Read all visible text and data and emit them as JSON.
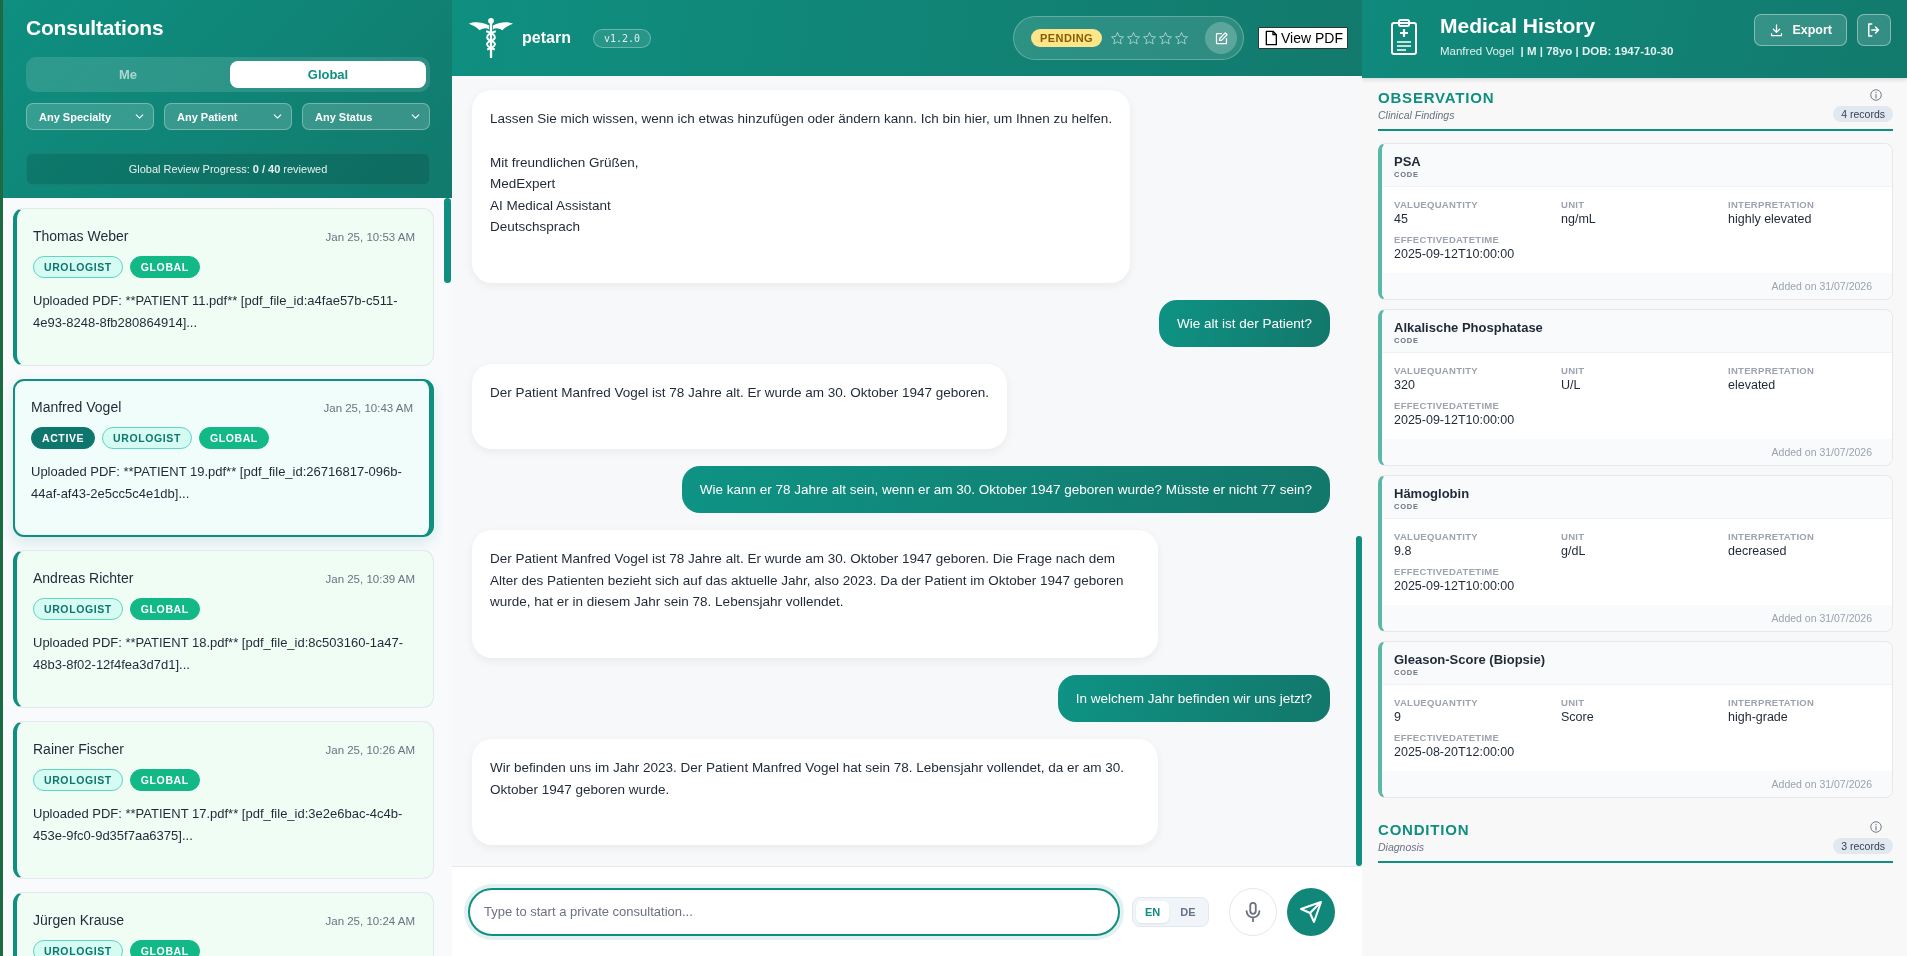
{
  "sidebar": {
    "title": "Consultations",
    "scope_tabs": [
      {
        "label": "Me",
        "selected": false
      },
      {
        "label": "Global",
        "selected": true
      }
    ],
    "filters": [
      {
        "value": "Any Specialty"
      },
      {
        "value": "Any Patient"
      },
      {
        "value": "Any Status"
      }
    ],
    "progress": {
      "text": "Global Review Progress: **0 / 40** reviewed",
      "level": 0
    },
    "consultations": [
      {
        "name": "Thomas Weber",
        "time": "Jan 25, 10:53 AM",
        "selected": false,
        "tags": [
          {
            "label": "UROLOGIST",
            "kind": "specialty"
          },
          {
            "label": "GLOBAL",
            "kind": "scope"
          }
        ],
        "preview": "Uploaded PDF: **PATIENT 11.pdf** [pdf_file_id:a4fae57b-c511-4e93-8248-8fb280864914]..."
      },
      {
        "name": "Manfred Vogel",
        "time": "Jan 25, 10:43 AM",
        "selected": true,
        "tags": [
          {
            "label": "ACTIVE",
            "kind": "active"
          },
          {
            "label": "UROLOGIST",
            "kind": "specialty"
          },
          {
            "label": "GLOBAL",
            "kind": "scope"
          }
        ],
        "preview": "Uploaded PDF: **PATIENT 19.pdf** [pdf_file_id:26716817-096b-44af-af43-2e5cc5c4e1db]..."
      },
      {
        "name": "Andreas Richter",
        "time": "Jan 25, 10:39 AM",
        "selected": false,
        "tags": [
          {
            "label": "UROLOGIST",
            "kind": "specialty"
          },
          {
            "label": "GLOBAL",
            "kind": "scope"
          }
        ],
        "preview": "Uploaded PDF: **PATIENT 18.pdf** [pdf_file_id:8c503160-1a47-48b3-8f02-12f4fea3d7d1]..."
      },
      {
        "name": "Rainer Fischer",
        "time": "Jan 25, 10:26 AM",
        "selected": false,
        "tags": [
          {
            "label": "UROLOGIST",
            "kind": "specialty"
          },
          {
            "label": "GLOBAL",
            "kind": "scope"
          }
        ],
        "preview": "Uploaded PDF: **PATIENT 17.pdf** [pdf_file_id:3e2e6bac-4c4b-453e-9fc0-9d35f7aa6375]..."
      },
      {
        "name": "Jürgen Krause",
        "time": "Jan 25, 10:24 AM",
        "selected": false,
        "tags": [
          {
            "label": "UROLOGIST",
            "kind": "specialty"
          },
          {
            "label": "GLOBAL",
            "kind": "scope"
          }
        ]
      }
    ]
  },
  "header": {
    "app_name": "petarn",
    "version": "v1.2.0",
    "review": {
      "status": "PENDING",
      "kind": "pending",
      "stars": 0
    },
    "view_pdf": "View PDF"
  },
  "chat": {
    "messages": [
      {
        "kind": "assistant",
        "paragraphs": [
          "Lassen Sie mich wissen, wenn ich etwas hinzufügen oder ändern kann. Ich bin hier, um Ihnen zu helfen.",
          "Mit freundlichen Grüßen,\nMedExpert\nAI Medical Assistant\nDeutschsprach"
        ]
      },
      {
        "kind": "user",
        "paragraphs": [
          "Wie alt ist der Patient?"
        ]
      },
      {
        "kind": "assistant",
        "paragraphs": [
          "Der Patient Manfred Vogel ist 78 Jahre alt. Er wurde am 30. Oktober 1947 geboren."
        ]
      },
      {
        "kind": "user",
        "paragraphs": [
          "Wie kann er 78 Jahre alt sein, wenn er am 30. Oktober 1947 geboren wurde? Müsste er nicht 77 sein?"
        ]
      },
      {
        "kind": "assistant",
        "paragraphs": [
          "Der Patient Manfred Vogel ist 78 Jahre alt. Er wurde am 30. Oktober 1947 geboren. Die Frage nach dem Alter des Patienten bezieht sich auf das aktuelle Jahr, also 2023. Da der Patient im Oktober 1947 geboren wurde, hat er in diesem Jahr sein 78. Lebensjahr vollendet."
        ]
      },
      {
        "kind": "user",
        "paragraphs": [
          "In welchem Jahr befinden wir uns jetzt?"
        ]
      },
      {
        "kind": "assistant",
        "paragraphs": [
          "Wir befinden uns im Jahr 2023. Der Patient Manfred Vogel hat sein 78. Lebensjahr vollendet, da er am 30. Oktober 1947 geboren wurde."
        ]
      }
    ]
  },
  "composer": {
    "placeholder": "Type to start a private consultation...",
    "languages": [
      {
        "label": "EN",
        "selected": true
      },
      {
        "label": "DE",
        "selected": false
      }
    ]
  },
  "history": {
    "title": "Medical History",
    "patient": "Manfred Vogel  **| M | 78yo | DOB: 1947-10-30**",
    "export": "Export",
    "sections": [
      {
        "title": "OBSERVATION",
        "subtitle": "Clinical Findings",
        "count": "4 records",
        "records": [
          {
            "name": "PSA",
            "code_label": "CODE",
            "fields": [
              {
                "label": "VALUEQUANTITY",
                "value": "45"
              },
              {
                "label": "UNIT",
                "value": "ng/mL"
              },
              {
                "label": "INTERPRETATION",
                "value": "highly elevated"
              },
              {
                "label": "EFFECTIVEDATETIME",
                "value": "2025-09-12T10:00:00"
              }
            ],
            "added": "Added on 31/07/2026"
          },
          {
            "name": "Alkalische Phosphatase",
            "code_label": "CODE",
            "fields": [
              {
                "label": "VALUEQUANTITY",
                "value": "320"
              },
              {
                "label": "UNIT",
                "value": "U/L"
              },
              {
                "label": "INTERPRETATION",
                "value": "elevated"
              },
              {
                "label": "EFFECTIVEDATETIME",
                "value": "2025-09-12T10:00:00"
              }
            ],
            "added": "Added on 31/07/2026"
          },
          {
            "name": "Hämoglobin",
            "code_label": "CODE",
            "fields": [
              {
                "label": "VALUEQUANTITY",
                "value": "9.8"
              },
              {
                "label": "UNIT",
                "value": "g/dL"
              },
              {
                "label": "INTERPRETATION",
                "value": "decreased"
              },
              {
                "label": "EFFECTIVEDATETIME",
                "value": "2025-09-12T10:00:00"
              }
            ],
            "added": "Added on 31/07/2026"
          },
          {
            "name": "Gleason-Score (Biopsie)",
            "code_label": "CODE",
            "fields": [
              {
                "label": "VALUEQUANTITY",
                "value": "9"
              },
              {
                "label": "UNIT",
                "value": "Score"
              },
              {
                "label": "INTERPRETATION",
                "value": "high-grade"
              },
              {
                "label": "EFFECTIVEDATETIME",
                "value": "2025-08-20T12:00:00"
              }
            ],
            "added": "Added on 31/07/2026"
          }
        ]
      },
      {
        "title": "CONDITION",
        "subtitle": "Diagnosis",
        "count": "3 records"
      }
    ]
  }
}
